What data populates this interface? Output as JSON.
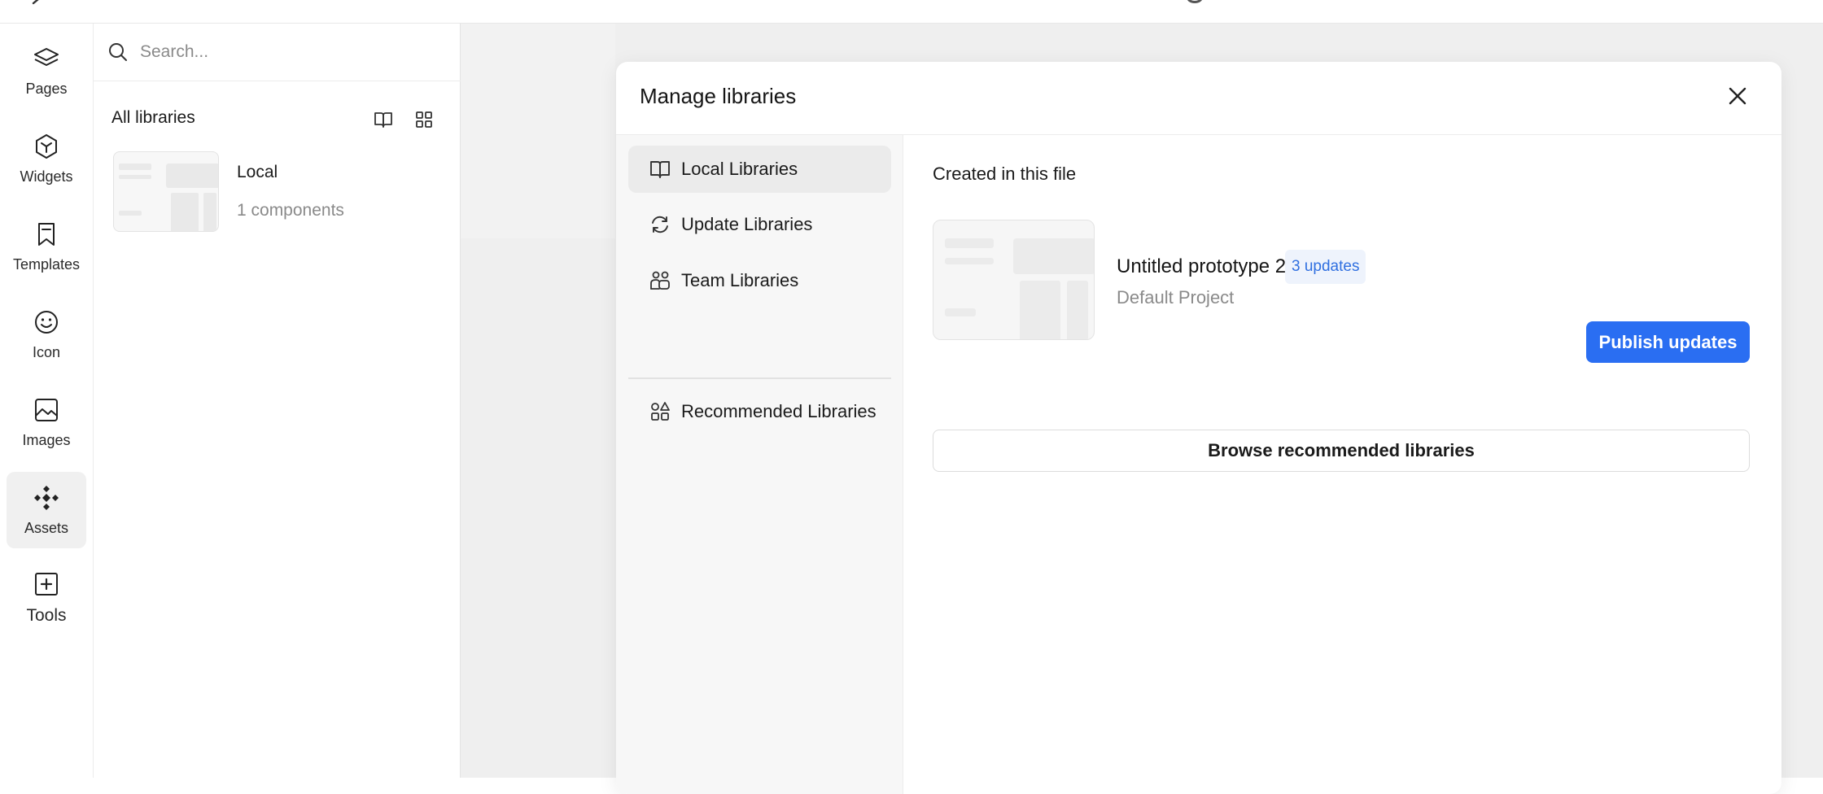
{
  "rail": {
    "items": [
      {
        "label": "Pages",
        "icon": "layers-icon"
      },
      {
        "label": "Widgets",
        "icon": "cube-icon"
      },
      {
        "label": "Templates",
        "icon": "bookmark-icon"
      },
      {
        "label": "Icon",
        "icon": "smiley-icon"
      },
      {
        "label": "Images",
        "icon": "image-icon"
      },
      {
        "label": "Assets",
        "icon": "assets-icon",
        "active": true
      },
      {
        "label": "Tools",
        "icon": "plus-square-icon"
      }
    ]
  },
  "panel": {
    "search_placeholder": "Search...",
    "section_title": "All libraries",
    "library": {
      "name": "Local",
      "count": "1 components"
    }
  },
  "modal": {
    "title": "Manage libraries",
    "nav": [
      {
        "label": "Local Libraries",
        "icon": "book-icon",
        "active": true
      },
      {
        "label": "Update Libraries",
        "icon": "refresh-icon"
      },
      {
        "label": "Team Libraries",
        "icon": "team-icon"
      },
      {
        "label": "Recommended Libraries",
        "icon": "shapes-icon"
      }
    ],
    "section_title": "Created in this file",
    "project": {
      "name": "Untitled prototype 2",
      "badge": "3 updates",
      "subtitle": "Default Project"
    },
    "publish_label": "Publish updates",
    "browse_label": "Browse recommended libraries"
  },
  "colors": {
    "accent": "#2a6ef2",
    "badge_bg": "#eef3fc",
    "badge_text": "#2f6fe0"
  }
}
